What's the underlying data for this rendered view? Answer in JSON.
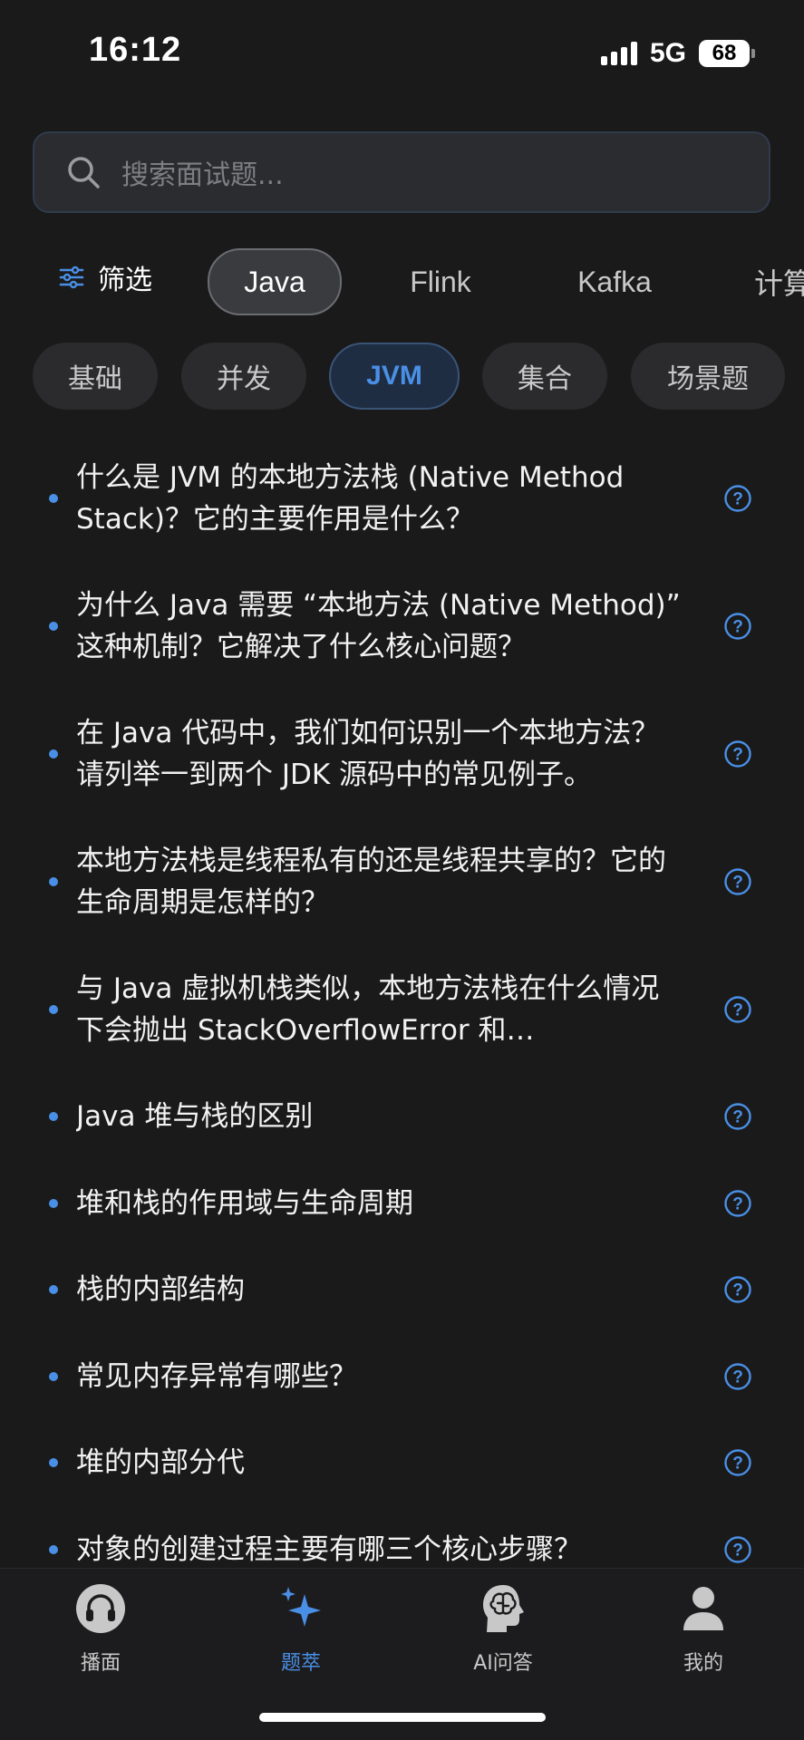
{
  "status": {
    "time": "16:12",
    "network": "5G",
    "battery": "68"
  },
  "search": {
    "placeholder": "搜索面试题..."
  },
  "filter": {
    "label": "筛选"
  },
  "categories": [
    {
      "label": "Java",
      "active": true
    },
    {
      "label": "Flink",
      "active": false
    },
    {
      "label": "Kafka",
      "active": false
    },
    {
      "label": "计算",
      "active": false
    }
  ],
  "subcategories": [
    {
      "label": "基础",
      "active": false
    },
    {
      "label": "并发",
      "active": false
    },
    {
      "label": "JVM",
      "active": true
    },
    {
      "label": "集合",
      "active": false
    },
    {
      "label": "场景题",
      "active": false
    }
  ],
  "questions": [
    {
      "text": "什么是 JVM 的本地方法栈 (Native Method Stack)？它的主要作用是什么？"
    },
    {
      "text": "为什么 Java 需要 “本地方法 (Native Method)” 这种机制？它解决了什么核心问题？"
    },
    {
      "text": "在 Java 代码中，我们如何识别一个本地方法？请列举一到两个 JDK 源码中的常见例子。"
    },
    {
      "text": "本地方法栈是线程私有的还是线程共享的？它的生命周期是怎样的？"
    },
    {
      "text": "与 Java 虚拟机栈类似，本地方法栈在什么情况下会抛出 StackOverflowError 和 OutOfMemoryError？"
    },
    {
      "text": "Java 堆与栈的区别"
    },
    {
      "text": "堆和栈的作用域与生命周期"
    },
    {
      "text": "栈的内部结构"
    },
    {
      "text": "常见内存异常有哪些？"
    },
    {
      "text": "堆的内部分代"
    },
    {
      "text": "对象的创建过程主要有哪三个核心步骤？"
    }
  ],
  "nav": [
    {
      "label": "播面",
      "icon": "headphones-icon",
      "active": false
    },
    {
      "label": "题萃",
      "icon": "sparkle-icon",
      "active": true
    },
    {
      "label": "AI问答",
      "icon": "ai-brain-icon",
      "active": false
    },
    {
      "label": "我的",
      "icon": "person-icon",
      "active": false
    }
  ],
  "colors": {
    "background": "#1a1a1a",
    "accent": "#4a8fe6",
    "text": "#f2f2f2",
    "muted": "#7d7f85"
  }
}
